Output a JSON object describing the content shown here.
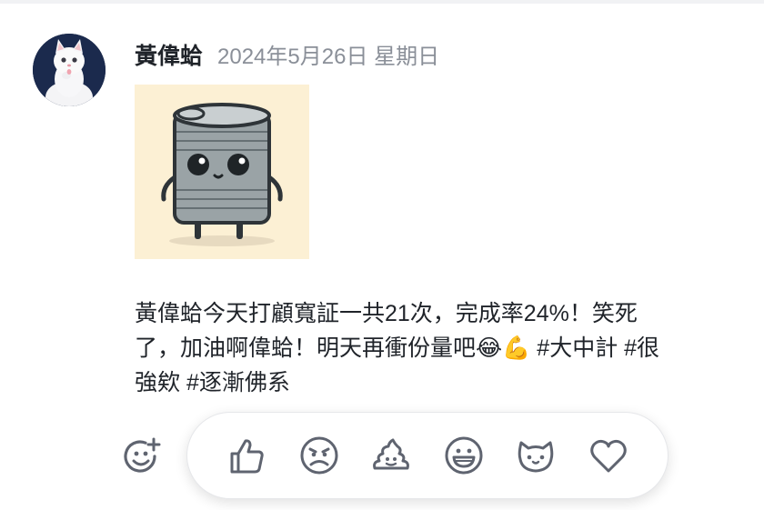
{
  "post": {
    "author": "黃偉蛤",
    "date": "2024年5月26日 星期日",
    "avatar_icon": "white-kitten-avatar",
    "attachment_icon": "cartoon-tin-can-illustration",
    "message_lines": [
      "黃偉蛤今天打顧寬証一共21次，完成率24%！笑死",
      "了，加油啊偉蛤！明天再衝份量吧😂💪 #大中計 #很",
      "強欸 #逐漸佛系"
    ]
  },
  "reactions": {
    "add_icon": "add-reaction-icon",
    "items": [
      {
        "icon": "thumbs-up-icon"
      },
      {
        "icon": "angry-face-icon"
      },
      {
        "icon": "poop-icon"
      },
      {
        "icon": "grinning-face-icon"
      },
      {
        "icon": "cat-face-icon"
      },
      {
        "icon": "heart-icon"
      }
    ]
  },
  "colors": {
    "text": "#1f2329",
    "muted": "#8a8f98",
    "icon": "#5f6470",
    "attachment_bg": "#fcf0d4"
  }
}
